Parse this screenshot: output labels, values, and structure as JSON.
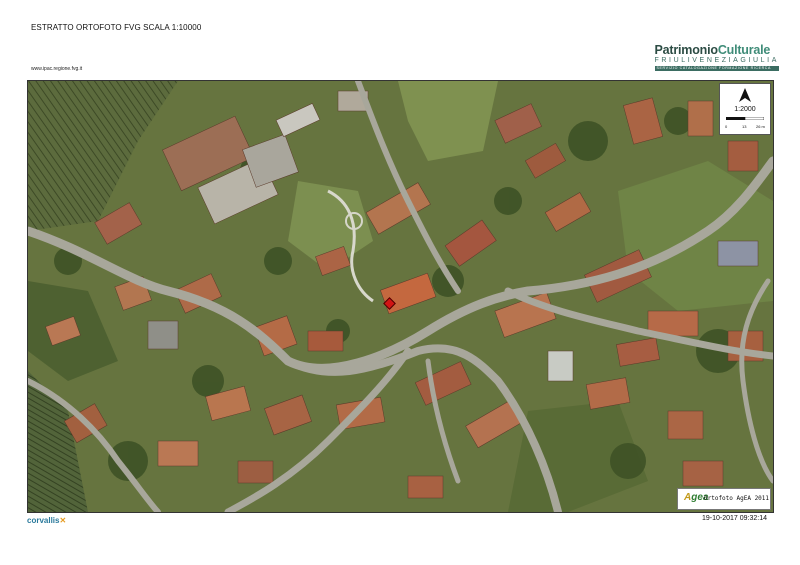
{
  "header": {
    "title": "ESTRATTO ORTOFOTO FVG SCALA 1:10000",
    "url": "www.ipac.regione.fvg.it"
  },
  "brand": {
    "name_part1": "Patrimonio",
    "name_part2": "Culturale",
    "subtitle": "FRIULIVENEZIAGIULIA",
    "tagline": "SERVIZIO CATALOGAZIONE FORMAZIONE RICERCA"
  },
  "map": {
    "scale_ratio": "1:2000",
    "scale_ticks": [
      "0",
      "13",
      "26 m"
    ],
    "north_arrow": "north-arrow-icon",
    "marker": "location-marker-icon",
    "agea_logo": "AGEA",
    "agea_credit": "Ortofoto AgEA 2011"
  },
  "footer": {
    "corvallis": "corvallis",
    "timestamp": "19-10-2017 09:32:14"
  },
  "colors": {
    "brand_green": "#3b6d62",
    "marker_red": "#d11414",
    "corvallis_blue": "#2b7a9c"
  }
}
